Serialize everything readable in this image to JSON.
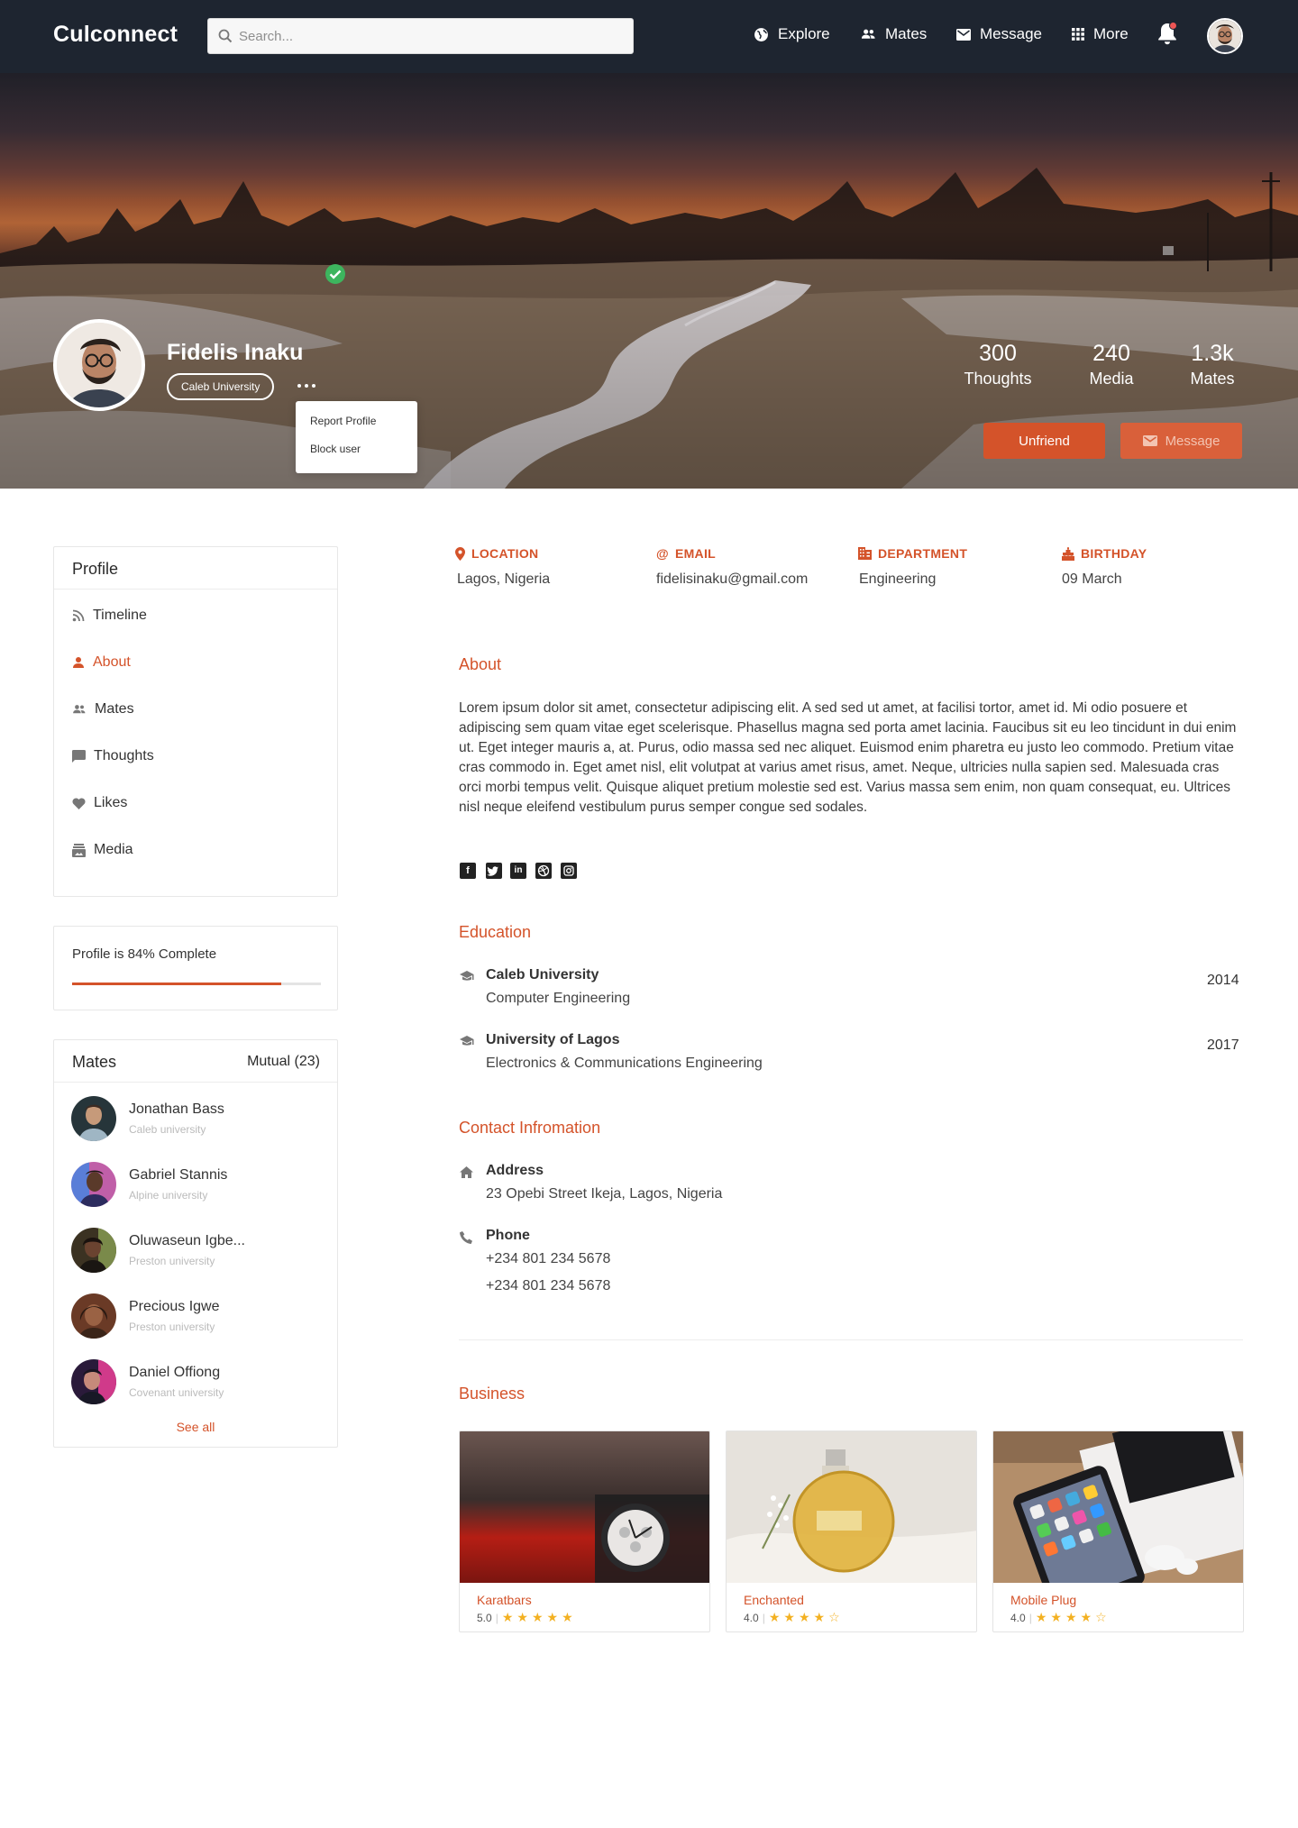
{
  "nav": {
    "brand": "Culconnect",
    "search_placeholder": "Search...",
    "items": [
      "Explore",
      "Mates",
      "Message",
      "More"
    ]
  },
  "profile": {
    "name": "Fidelis Inaku",
    "university": "Caleb University",
    "menu": [
      "Report Profile",
      "Block user"
    ],
    "stats": [
      {
        "value": "300",
        "label": "Thoughts"
      },
      {
        "value": "240",
        "label": "Media"
      },
      {
        "value": "1.3k",
        "label": "Mates"
      }
    ],
    "unfriend_label": "Unfriend",
    "message_label": "Message"
  },
  "sidebar": {
    "title": "Profile",
    "items": [
      "Timeline",
      "About",
      "Mates",
      "Thoughts",
      "Likes",
      "Media"
    ],
    "active": "About",
    "completion_text": "Profile is 84% Complete",
    "completion_percent": 84
  },
  "mates": {
    "title": "Mates",
    "mutual": "Mutual (23)",
    "list": [
      {
        "name": "Jonathan Bass",
        "school": "Caleb university"
      },
      {
        "name": "Gabriel Stannis",
        "school": "Alpine university"
      },
      {
        "name": "Oluwaseun Igbe...",
        "school": "Preston university"
      },
      {
        "name": "Precious Igwe",
        "school": "Preston university"
      },
      {
        "name": "Daniel Offiong",
        "school": "Covenant university"
      }
    ],
    "see_all": "See all"
  },
  "info": {
    "location_label": "LOCATION",
    "location": "Lagos, Nigeria",
    "email_label": "EMAIL",
    "email": "fidelisinaku@gmail.com",
    "department_label": "DEPARTMENT",
    "department": "Engineering",
    "birthday_label": "BIRTHDAY",
    "birthday": "09 March"
  },
  "about": {
    "title": "About",
    "text": "Lorem ipsum dolor sit amet, consectetur adipiscing elit. A sed sed ut amet, at facilisi tortor, amet id. Mi odio posuere et adipiscing sem quam vitae eget scelerisque. Phasellus magna sed porta amet lacinia. Faucibus sit eu leo tincidunt in dui enim ut. Eget integer mauris a, at. Purus, odio massa sed nec aliquet. Euismod enim pharetra eu justo leo commodo. Pretium vitae cras commodo in. Eget amet nisl, elit volutpat at varius amet risus, amet. Neque, ultricies nulla sapien sed. Malesuada cras orci morbi tempus velit. Quisque aliquet pretium molestie sed est. Varius massa sem enim, non quam consequat, eu. Ultrices nisl neque eleifend vestibulum purus semper congue sed sodales.",
    "social_icons": [
      "facebook-icon",
      "twitter-icon",
      "linkedin-icon",
      "dribbble-icon",
      "instagram-icon"
    ]
  },
  "education": {
    "title": "Education",
    "items": [
      {
        "school": "Caleb University",
        "course": "Computer Engineering",
        "year": "2014"
      },
      {
        "school": "University of Lagos",
        "course": "Electronics & Communications Engineering",
        "year": "2017"
      }
    ]
  },
  "contact": {
    "title": "Contact Infromation",
    "address_label": "Address",
    "address": "23 Opebi Street Ikeja, Lagos, Nigeria",
    "phone_label": "Phone",
    "phones": [
      "+234 801 234 5678",
      "+234 801 234 5678"
    ]
  },
  "business": {
    "title": "Business",
    "items": [
      {
        "name": "Karatbars",
        "rating": "5.0",
        "stars": 5
      },
      {
        "name": "Enchanted",
        "rating": "4.0",
        "stars": 4
      },
      {
        "name": "Mobile Plug",
        "rating": "4.0",
        "stars": 4
      }
    ]
  },
  "colors": {
    "accent": "#d4532a",
    "nav": "#1e2530",
    "verified": "#3db55e",
    "star": "#f3b122"
  }
}
